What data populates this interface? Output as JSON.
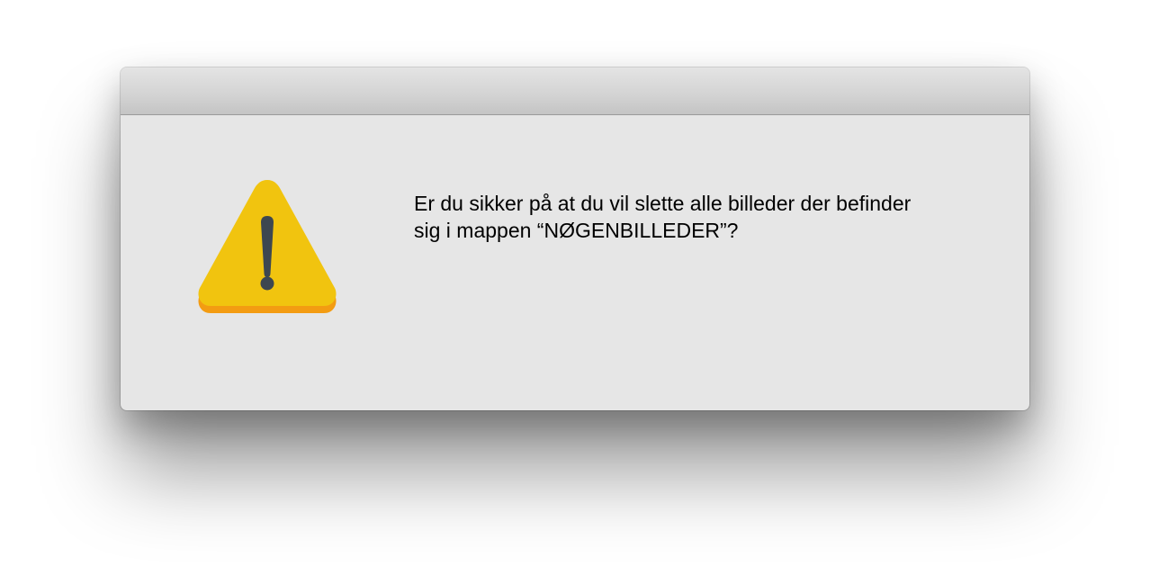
{
  "dialog": {
    "message": "Er du sikker på at du vil slette alle billeder der befinder\nsig i mappen “NØGENBILLEDER”?",
    "icon": "warning-triangle-icon",
    "colors": {
      "icon_fill": "#f1c40f",
      "icon_edge": "#f39c12",
      "icon_mark": "#3d4750",
      "background": "#e6e6e6"
    }
  }
}
